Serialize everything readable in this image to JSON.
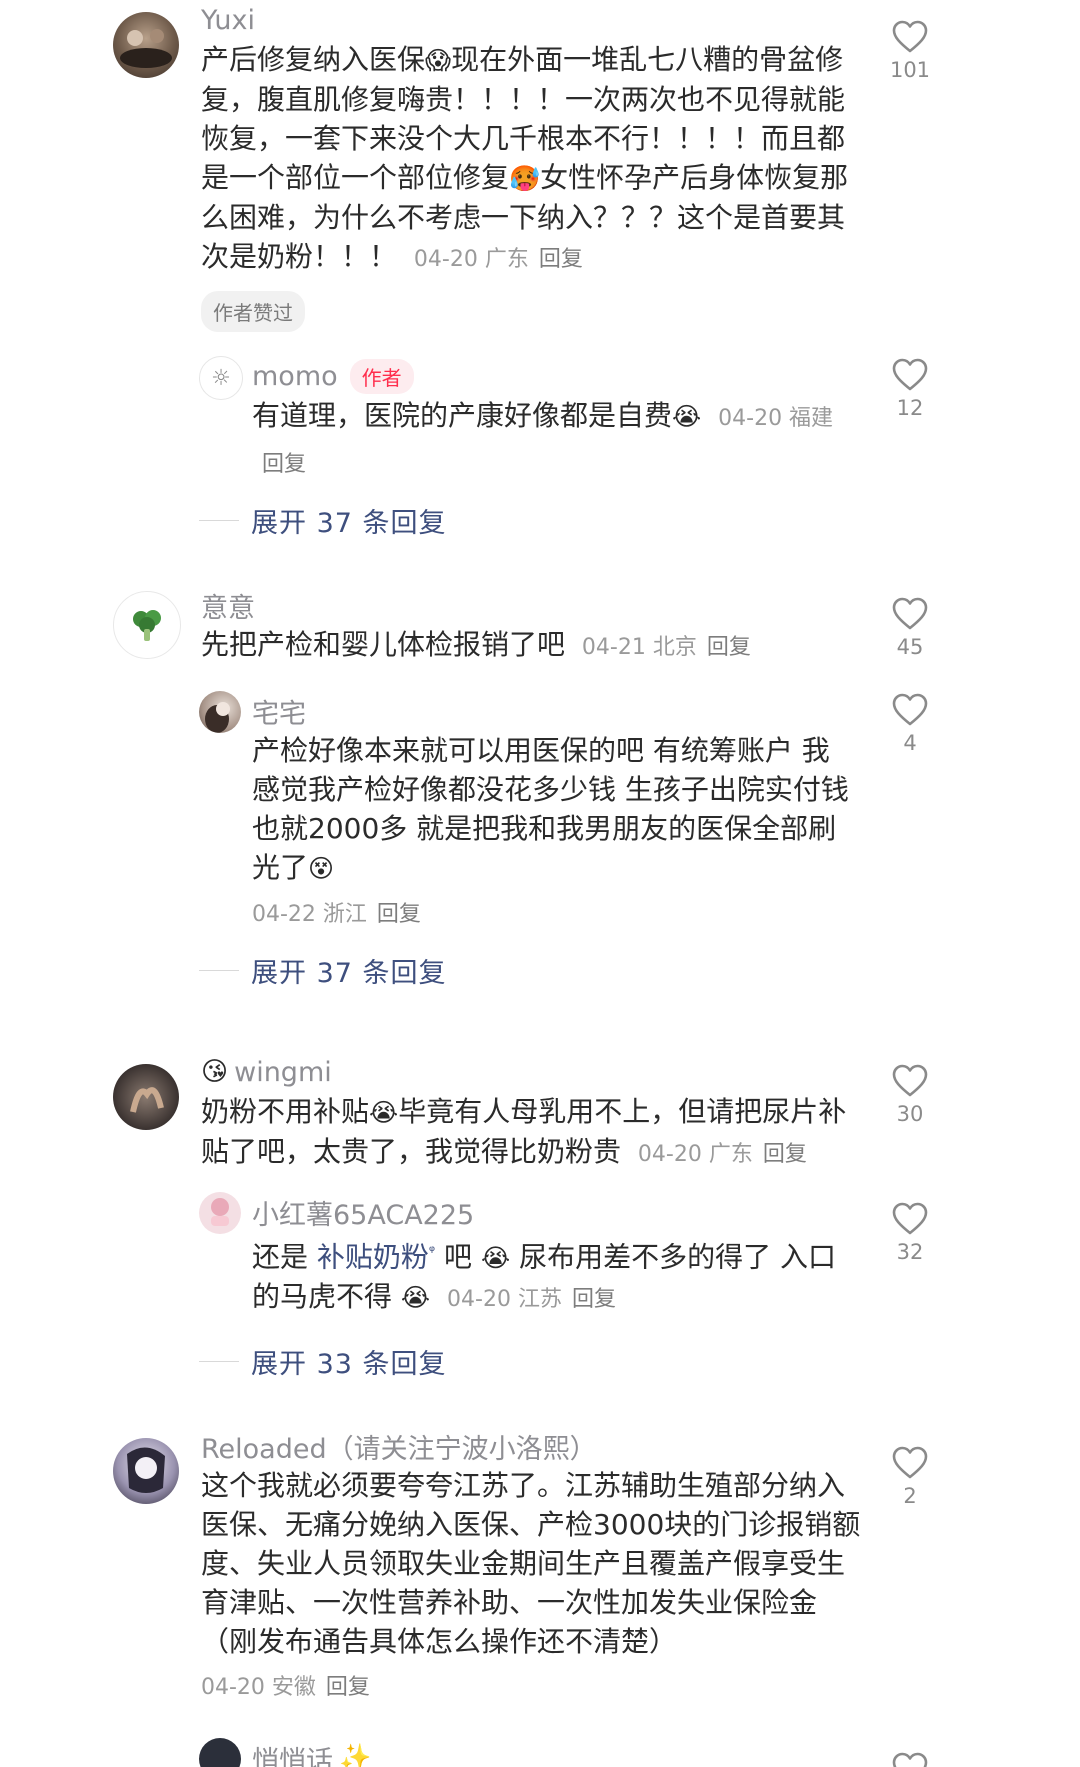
{
  "threads": [
    {
      "top": {
        "username": "Yuxi",
        "content_parts": [
          "产后修复纳入医保",
          "现在外面一堆乱七八糟的骨盆修复，腹直肌修复嗨贵！！！！一次两次也不见得就能恢复，一套下来没个大几千根本不行！！！！而且都是一个部位一个部位修复",
          "女性怀孕产后身体恢复那么困难，为什么不考虑一下纳入？？？这个是首要其次是奶粉！！！"
        ],
        "emoji1": "😱",
        "emoji2": "🥵",
        "date_loc": "04-20 广东",
        "reply_label": "回复",
        "liked_badge": "作者赞过",
        "likes": "101"
      },
      "reply": {
        "username": "momo",
        "author_tag": "作者",
        "content": "有道理，医院的产康好像都是自费",
        "emoji": "😭",
        "date_loc": "04-20 福建",
        "reply_label": "回复",
        "likes": "12"
      },
      "expand": "展开 37 条回复"
    },
    {
      "top": {
        "username": "意意",
        "content": "先把产检和婴儿体检报销了吧",
        "date_loc": "04-21 北京",
        "reply_label": "回复",
        "likes": "45"
      },
      "reply": {
        "username": "宅宅",
        "content": "产检好像本来就可以用医保的吧 有统筹账户 我感觉我产检好像都没花多少钱 生孩子出院实付钱也就2000多 就是把我和我男朋友的医保全部刷光了",
        "emoji": "😵",
        "date_loc": "04-22 浙江",
        "reply_label": "回复",
        "likes": "4"
      },
      "expand": "展开 37 条回复"
    },
    {
      "top": {
        "username": "wingmi",
        "name_emoji": "😘",
        "content_a": "奶粉不用补贴",
        "emoji": "😭",
        "content_b": "毕竟有人母乳用不上，但请把尿片补贴了吧，太贵了，我觉得比奶粉贵",
        "date_loc": "04-20 广东",
        "reply_label": "回复",
        "likes": "30"
      },
      "reply": {
        "username": "小红薯65ACA225",
        "content_a": "还是 ",
        "link": "补贴奶粉",
        "link_icon": "ᵠ",
        "content_b": " 吧 ",
        "emoji1": "😭",
        "content_c": " 尿布用差不多的得了 入口的马虎不得 ",
        "emoji2": "😭",
        "date_loc": "04-20 江苏",
        "reply_label": "回复",
        "likes": "32"
      },
      "expand": "展开 33 条回复"
    },
    {
      "top": {
        "username": "Reloaded（请关注宁波小洛熙）",
        "content": "这个我就必须要夸夸江苏了。江苏辅助生殖部分纳入医保、无痛分娩纳入医保、产检3000块的门诊报销额度、失业人员领取失业金期间生产且覆盖产假享受生育津贴、一次性营养补助、一次性加发失业保险金（刚发布通告具体怎么操作还不清楚）",
        "date_loc": "04-20 安徽",
        "reply_label": "回复",
        "likes": "2"
      }
    },
    {
      "top": {
        "username": "悄悄话",
        "name_emoji": "✨"
      }
    }
  ],
  "colors": {
    "author_tag": "#ff2e4d",
    "link": "#3e4f7e",
    "meta": "#9a9a9a"
  },
  "icons": {
    "like": "heart-outline-icon"
  }
}
